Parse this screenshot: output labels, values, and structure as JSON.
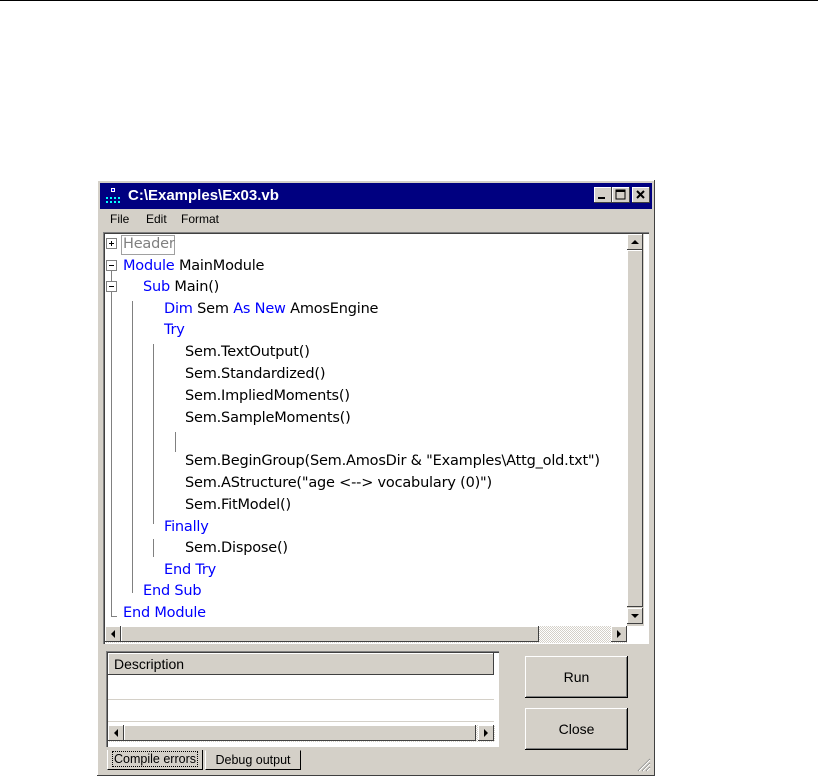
{
  "window": {
    "title": "C:\\Examples\\Ex03.vb",
    "minimize_label": "minimize",
    "maximize_label": "maximize",
    "close_label": "close"
  },
  "menu": [
    "File",
    "Edit",
    "Format"
  ],
  "code": {
    "header": "Header",
    "line_module_kw": "Module",
    "line_module_name": " MainModule",
    "line_sub_kw": "Sub",
    "line_sub_rest": " Main()",
    "line_dim_kw": "Dim",
    "line_dim_mid": " Sem ",
    "line_dim_kw2": "As New",
    "line_dim_rest": " AmosEngine",
    "line_try": "Try",
    "l1": "Sem.TextOutput()",
    "l2": "Sem.Standardized()",
    "l3": "Sem.ImpliedMoments()",
    "l4": "Sem.SampleMoments()",
    "l5": "Sem.BeginGroup(Sem.AmosDir & \"Examples\\Attg_old.txt\")",
    "l6": "Sem.AStructure(\"age <--> vocabulary (0)\")",
    "l7": "Sem.FitModel()",
    "finally": "Finally",
    "l8": "Sem.Dispose()",
    "end_try": "End Try",
    "end_sub": "End Sub",
    "end_module": "End Module"
  },
  "description": {
    "header": "Description"
  },
  "buttons": {
    "run": "Run",
    "close": "Close"
  },
  "tabs": [
    "Compile errors",
    "Debug output"
  ],
  "colors": {
    "keyword": "#0000ff",
    "titlebar": "#000080",
    "chrome": "#d4d0c8"
  }
}
